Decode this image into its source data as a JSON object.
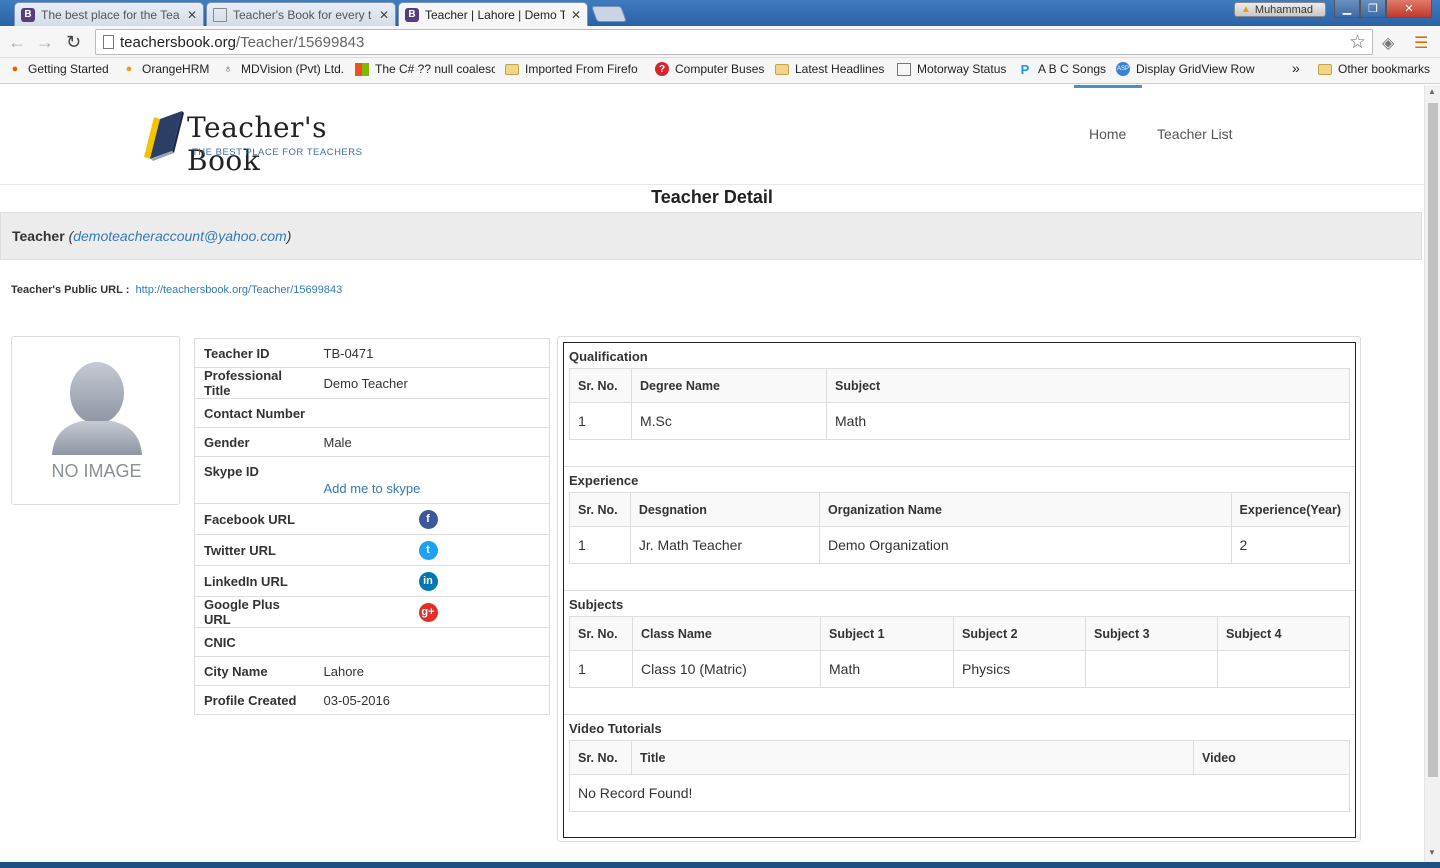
{
  "browser": {
    "tabs": [
      {
        "label": "The best place for the Tea",
        "favicon": "B",
        "active": false
      },
      {
        "label": "Teacher's Book for every t",
        "favicon": "doc",
        "active": false
      },
      {
        "label": "Teacher | Lahore | Demo T",
        "favicon": "B",
        "active": true
      }
    ],
    "user": "Muhammad",
    "url_host": "teachersbook.org",
    "url_path": "/Teacher/15699843",
    "bookmarks": [
      {
        "label": "Getting Started",
        "icon": "firefox-icon"
      },
      {
        "label": "OrangeHRM",
        "icon": "orange-icon"
      },
      {
        "label": "MDVision (Pvt) Ltd.",
        "icon": "mdvision-icon"
      },
      {
        "label": "The C# ?? null coalesc",
        "icon": "windows-icon"
      },
      {
        "label": "Imported From Firefo",
        "icon": "folder-icon"
      },
      {
        "label": "Computer Buses",
        "icon": "question-icon"
      },
      {
        "label": "Latest Headlines",
        "icon": "folder-icon"
      },
      {
        "label": "Motorway Status",
        "icon": "doc-icon"
      },
      {
        "label": "A B C Songs",
        "icon": "p-icon"
      },
      {
        "label": "Display GridView Row",
        "icon": "asp-icon"
      }
    ],
    "bookmarks_overflow": "»",
    "other_bookmarks": "Other bookmarks"
  },
  "site": {
    "logo_title": "Teacher's Book",
    "logo_tagline": "THE BEST PLACE FOR TEACHERS",
    "nav": [
      "Home",
      "Teacher List"
    ]
  },
  "page": {
    "title": "Teacher Detail",
    "teacher_label": "Teacher",
    "teacher_email": "demoteacheraccount@yahoo.com",
    "paren_open": "(",
    "paren_close": ")",
    "public_url_label": "Teacher's Public URL :",
    "public_url": "http://teachersbook.org/Teacher/15699843",
    "no_image": "NO IMAGE"
  },
  "info": [
    {
      "key": "Teacher ID",
      "value": "TB-0471"
    },
    {
      "key": "Professional Title",
      "value": "Demo Teacher"
    },
    {
      "key": "Contact Number",
      "value": ""
    },
    {
      "key": "Gender",
      "value": "Male"
    },
    {
      "key": "Skype ID",
      "value": "Add me to skype"
    },
    {
      "key": "Facebook URL",
      "value": "f"
    },
    {
      "key": "Twitter URL",
      "value": "t"
    },
    {
      "key": "LinkedIn URL",
      "value": "in"
    },
    {
      "key": "Google Plus URL",
      "value": "g+"
    },
    {
      "key": "CNIC",
      "value": ""
    },
    {
      "key": "City Name",
      "value": "Lahore"
    },
    {
      "key": "Profile Created",
      "value": "03-05-2016"
    }
  ],
  "colors": {
    "facebook": "#3b5998",
    "twitter": "#1da1f2",
    "linkedin": "#0077b5",
    "google_plus": "#e52d27",
    "link": "#337ab7"
  },
  "qualification": {
    "title": "Qualification",
    "headers": [
      "Sr. No.",
      "Degree Name",
      "Subject"
    ],
    "rows": [
      [
        "1",
        "M.Sc",
        "Math"
      ]
    ]
  },
  "experience": {
    "title": "Experience",
    "headers": [
      "Sr. No.",
      "Desgnation",
      "Organization Name",
      "Experience(Year)"
    ],
    "rows": [
      [
        "1",
        "Jr. Math Teacher",
        "Demo Organization",
        "2"
      ]
    ]
  },
  "subjects": {
    "title": "Subjects",
    "headers": [
      "Sr. No.",
      "Class Name",
      "Subject 1",
      "Subject 2",
      "Subject 3",
      "Subject 4"
    ],
    "rows": [
      [
        "1",
        "Class 10 (Matric)",
        "Math",
        "Physics",
        "",
        ""
      ]
    ]
  },
  "videos": {
    "title": "Video Tutorials",
    "headers": [
      "Sr. No.",
      "Title",
      "Video"
    ],
    "empty": "No Record Found!"
  }
}
